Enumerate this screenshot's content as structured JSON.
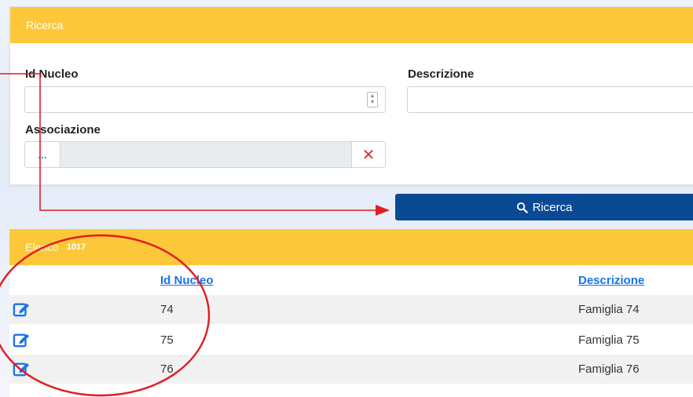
{
  "search": {
    "header": "Ricerca",
    "id_nucleo_label": "Id Nucleo",
    "id_nucleo_value": "",
    "descrizione_label": "Descrizione",
    "descrizione_value": "",
    "associazione_label": "Associazione",
    "associazione_button": "...",
    "clear_symbol": "✕",
    "search_button": "Ricerca"
  },
  "results": {
    "header": "Elenco",
    "count": "1017",
    "columns": [
      "Id Nucleo",
      "Descrizione"
    ],
    "rows": [
      {
        "id": "74",
        "descrizione": "Famiglia 74"
      },
      {
        "id": "75",
        "descrizione": "Famiglia 75"
      },
      {
        "id": "76",
        "descrizione": "Famiglia 76"
      }
    ]
  },
  "colors": {
    "header_yellow": "#fcc83a",
    "button_blue": "#0a4a94",
    "link_blue": "#1a73e8",
    "annotation_red": "#e31b23"
  },
  "icons": [
    "search-icon",
    "edit-icon",
    "close-icon",
    "spinner-icon"
  ]
}
